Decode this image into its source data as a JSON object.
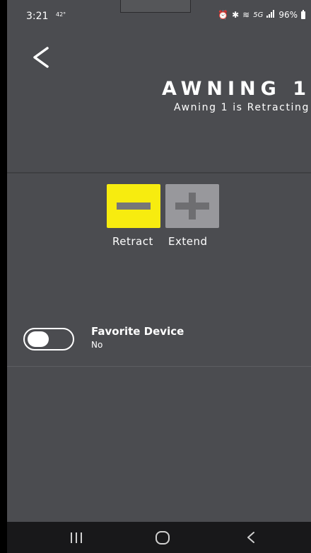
{
  "status_bar": {
    "time": "3:21",
    "temperature": "42°",
    "network": "5G",
    "battery": "96%",
    "icons": [
      "alarm-icon",
      "bluetooth-icon",
      "mute-icon",
      "network-5g-icon",
      "signal-icon",
      "battery-icon"
    ]
  },
  "header": {
    "back_icon": "back-chevron-icon",
    "title": "AWNING 1",
    "status": "Awning 1 is Retracting"
  },
  "controls": {
    "retract": {
      "label": "Retract",
      "icon": "minus-icon",
      "active": true,
      "color": "#f7ec0f"
    },
    "extend": {
      "label": "Extend",
      "icon": "plus-icon",
      "active": false,
      "color": "#98989c"
    }
  },
  "favorite": {
    "title": "Favorite Device",
    "value": "No",
    "enabled": false
  },
  "navigation": {
    "icons": [
      "recents-icon",
      "home-icon",
      "back-icon"
    ]
  },
  "colors": {
    "background": "#4b4c50",
    "accent_active": "#f7ec0f",
    "nav_bar": "#18181a"
  }
}
